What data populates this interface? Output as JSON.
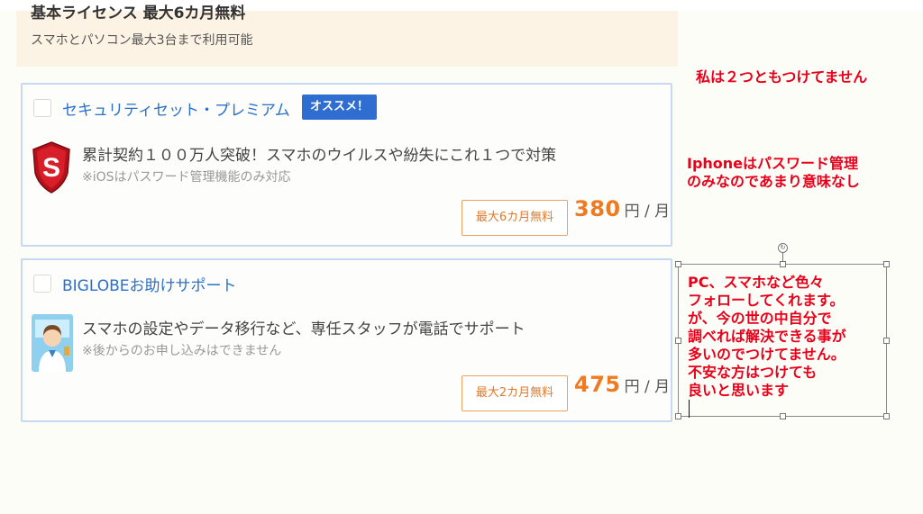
{
  "banner": {
    "title": "基本ライセンス 最大6カ月無料",
    "subtitle": "スマホとパソコン最大3台まで利用可能"
  },
  "options": [
    {
      "title": "セキュリティセット・プレミアム",
      "badge": "オススメ！",
      "icon": "shield-s-icon",
      "description": "累計契約１００万人突破！スマホのウイルスや紛失にこれ１つで対策",
      "note": "※iOSはパスワード管理機能のみ対応",
      "free_period": "最大6カ月無料",
      "price": "380",
      "unit": "円 / 月"
    },
    {
      "title": "BIGLOBEお助けサポート",
      "icon": "support-operator-icon",
      "description": "スマホの設定やデータ移行など、専任スタッフが電話でサポート",
      "note": "※後からのお申し込みはできません",
      "free_period": "最大2カ月無料",
      "price": "475",
      "unit": "円 / 月"
    }
  ],
  "annotations": {
    "note1": "私は２つともつけてません",
    "note2": [
      "Iphoneはパスワード管理",
      "のみなのであまり意味なし"
    ],
    "textbox": [
      "PC、スマホなど色々",
      "フォローしてくれます。",
      "が、今の世の中自分で",
      "調べれば解決できる事が",
      "多いのでつけてません。",
      "不安な方はつけても",
      "良いと思います"
    ]
  },
  "colors": {
    "accent_blue": "#2a6fc9",
    "badge_blue": "#2f6dd0",
    "price_orange": "#ee7b22",
    "annotation_red": "#e8001b"
  }
}
